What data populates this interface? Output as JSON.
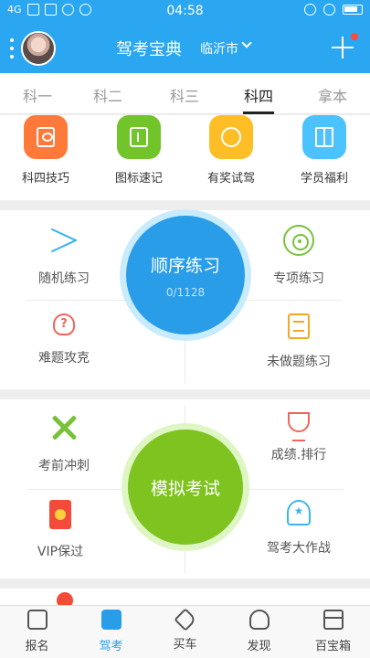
{
  "status_bar": {
    "network": "4G",
    "time": "04:58"
  },
  "header": {
    "title": "驾考宝典",
    "city": "临沂市"
  },
  "tabs": [
    {
      "label": "科一",
      "active": false
    },
    {
      "label": "科二",
      "active": false
    },
    {
      "label": "科三",
      "active": false
    },
    {
      "label": "科四",
      "active": true
    },
    {
      "label": "拿本",
      "active": false
    }
  ],
  "quick_links": [
    {
      "label": "科四技巧",
      "icon": "book-icon",
      "color": "#ff7a3a"
    },
    {
      "label": "图标速记",
      "icon": "sign-board-icon",
      "color": "#71c42a"
    },
    {
      "label": "有奖试驾",
      "icon": "steering-wheel-icon",
      "color": "#ffbd26"
    },
    {
      "label": "学员福利",
      "icon": "gift-icon",
      "color": "#4cc2ff"
    }
  ],
  "practice": {
    "random": "随机练习",
    "special": "专项练习",
    "difficult": "难题攻克",
    "undone": "未做题练习",
    "sequential": {
      "title": "顺序练习",
      "progress": "0/1128"
    }
  },
  "exam": {
    "sprint": "考前冲刺",
    "ranking": "成绩.排行",
    "vip": "VIP保过",
    "battle": "驾考大作战",
    "mock": {
      "title": "模拟考试"
    }
  },
  "bottom_nav": [
    {
      "label": "报名",
      "icon": "id-card-icon",
      "active": false
    },
    {
      "label": "驾考",
      "icon": "pencil-note-icon",
      "active": true
    },
    {
      "label": "买车",
      "icon": "price-tag-icon",
      "active": false
    },
    {
      "label": "发现",
      "icon": "person-icon",
      "active": false
    },
    {
      "label": "百宝箱",
      "icon": "treasure-box-icon",
      "active": false
    }
  ],
  "colors": {
    "brand_blue": "#2aa7f0",
    "accent_blue": "#2a9de8",
    "accent_green": "#7ec31f"
  }
}
